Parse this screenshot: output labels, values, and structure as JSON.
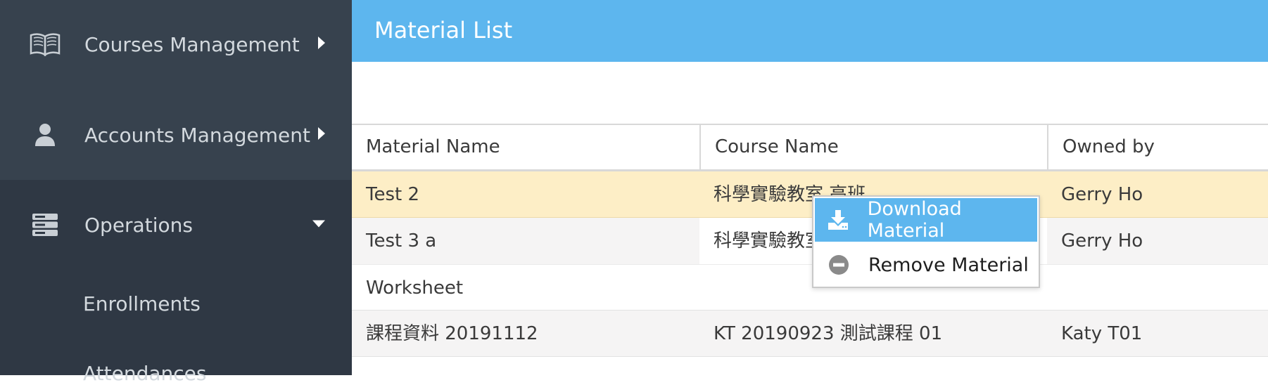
{
  "sidebar": {
    "items": [
      {
        "label": "Courses Management",
        "icon": "book-icon",
        "state": "collapsed"
      },
      {
        "label": "Accounts Management",
        "icon": "user-icon",
        "state": "collapsed"
      },
      {
        "label": "Operations",
        "icon": "server-icon",
        "state": "expanded"
      }
    ],
    "subitems": [
      {
        "label": "Enrollments"
      },
      {
        "label": "Attendances"
      }
    ]
  },
  "main": {
    "title": "Material List",
    "table": {
      "headers": [
        "Material Name",
        "Course Name",
        "Owned by"
      ],
      "rows": [
        {
          "material": "Test 2",
          "course": "科學實驗教室 高班",
          "owner": "Gerry Ho",
          "state": "highlighted"
        },
        {
          "material": "Test 3 a",
          "course": "科學實驗教室",
          "owner": "Gerry Ho"
        },
        {
          "material": "Worksheet",
          "course": "",
          "owner": ""
        },
        {
          "material": "課程資料 20191112",
          "course": "KT 20190923 測試課程 01",
          "owner": "Katy T01"
        }
      ]
    }
  },
  "context_menu": {
    "items": [
      {
        "label": "Download Material",
        "icon": "download-icon",
        "state": "hovered"
      },
      {
        "label": "Remove Material",
        "icon": "minus-circle-icon"
      }
    ]
  },
  "colors": {
    "sidebar_bg": "#2f3844",
    "sidebar_collapsed_bg": "#37424e",
    "header_bg": "#5db6ee",
    "highlight_row": "#fdeec6",
    "alt_row": "#f5f4f4",
    "menu_hover": "#5db6ee"
  }
}
